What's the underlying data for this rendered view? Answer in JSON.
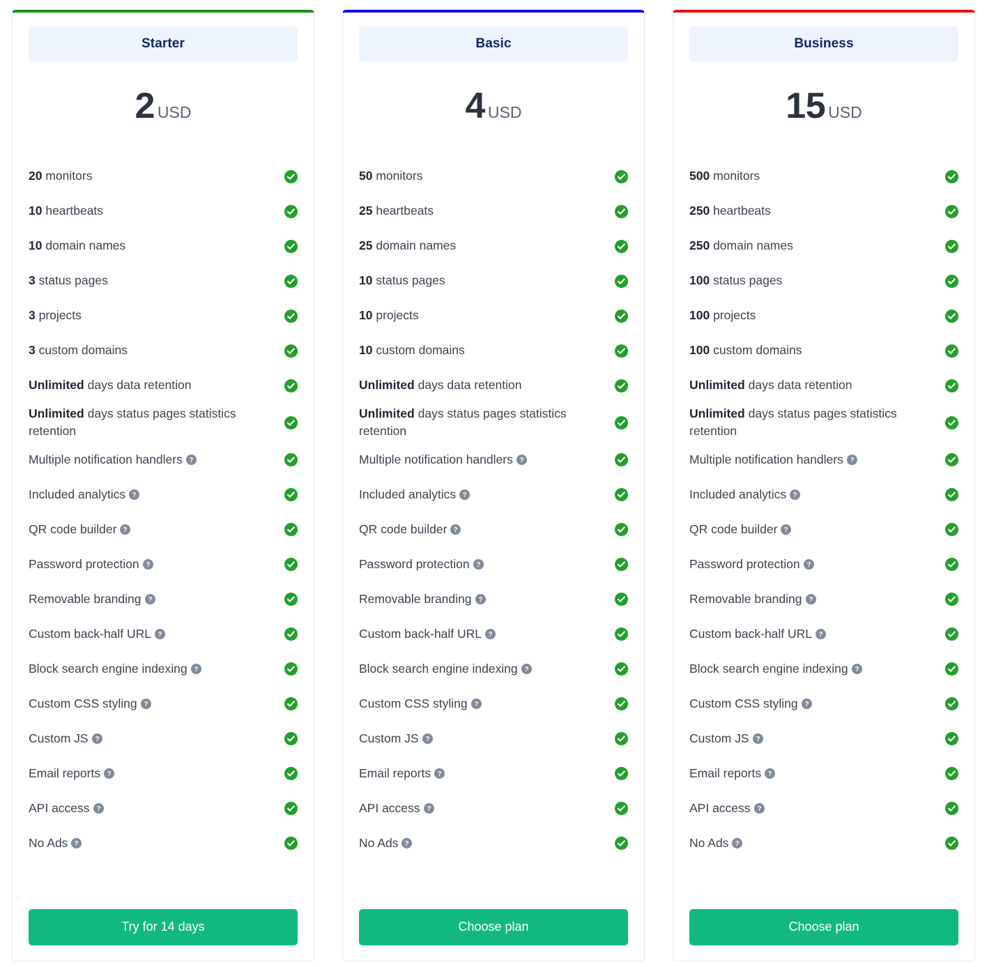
{
  "icons": {
    "check": "check-circle-icon",
    "help": "help-circle-icon"
  },
  "colors": {
    "accent_starter": "#139213",
    "accent_basic": "#0d0df0",
    "accent_business": "#f00a0a",
    "cta_green": "#11b981",
    "check_green": "#22a02b",
    "help_gray": "#818a99",
    "title_bar_bg": "#eef4fd",
    "title_text": "#142664"
  },
  "plans": [
    {
      "id": "starter",
      "name": "Starter",
      "price": "2",
      "currency": "USD",
      "cta_label": "Try for 14 days",
      "features": [
        {
          "qty": "20",
          "label": "monitors",
          "help": false,
          "included": true
        },
        {
          "qty": "10",
          "label": "heartbeats",
          "help": false,
          "included": true
        },
        {
          "qty": "10",
          "label": "domain names",
          "help": false,
          "included": true
        },
        {
          "qty": "3",
          "label": "status pages",
          "help": false,
          "included": true
        },
        {
          "qty": "3",
          "label": "projects",
          "help": false,
          "included": true
        },
        {
          "qty": "3",
          "label": "custom domains",
          "help": false,
          "included": true
        },
        {
          "qty": "Unlimited",
          "label": "days data retention",
          "help": false,
          "included": true
        },
        {
          "qty": "Unlimited",
          "label": "days status pages statistics retention",
          "help": false,
          "included": true
        },
        {
          "qty": "",
          "label": "Multiple notification handlers",
          "help": true,
          "included": true
        },
        {
          "qty": "",
          "label": "Included analytics",
          "help": true,
          "included": true
        },
        {
          "qty": "",
          "label": "QR code builder",
          "help": true,
          "included": true
        },
        {
          "qty": "",
          "label": "Password protection",
          "help": true,
          "included": true
        },
        {
          "qty": "",
          "label": "Removable branding",
          "help": true,
          "included": true
        },
        {
          "qty": "",
          "label": "Custom back-half URL",
          "help": true,
          "included": true
        },
        {
          "qty": "",
          "label": "Block search engine indexing",
          "help": true,
          "included": true
        },
        {
          "qty": "",
          "label": "Custom CSS styling",
          "help": true,
          "included": true
        },
        {
          "qty": "",
          "label": "Custom JS",
          "help": true,
          "included": true
        },
        {
          "qty": "",
          "label": "Email reports",
          "help": true,
          "included": true
        },
        {
          "qty": "",
          "label": "API access",
          "help": true,
          "included": true
        },
        {
          "qty": "",
          "label": "No Ads",
          "help": true,
          "included": true
        }
      ]
    },
    {
      "id": "basic",
      "name": "Basic",
      "price": "4",
      "currency": "USD",
      "cta_label": "Choose plan",
      "features": [
        {
          "qty": "50",
          "label": "monitors",
          "help": false,
          "included": true
        },
        {
          "qty": "25",
          "label": "heartbeats",
          "help": false,
          "included": true
        },
        {
          "qty": "25",
          "label": "domain names",
          "help": false,
          "included": true
        },
        {
          "qty": "10",
          "label": "status pages",
          "help": false,
          "included": true
        },
        {
          "qty": "10",
          "label": "projects",
          "help": false,
          "included": true
        },
        {
          "qty": "10",
          "label": "custom domains",
          "help": false,
          "included": true
        },
        {
          "qty": "Unlimited",
          "label": "days data retention",
          "help": false,
          "included": true
        },
        {
          "qty": "Unlimited",
          "label": "days status pages statistics retention",
          "help": false,
          "included": true
        },
        {
          "qty": "",
          "label": "Multiple notification handlers",
          "help": true,
          "included": true
        },
        {
          "qty": "",
          "label": "Included analytics",
          "help": true,
          "included": true
        },
        {
          "qty": "",
          "label": "QR code builder",
          "help": true,
          "included": true
        },
        {
          "qty": "",
          "label": "Password protection",
          "help": true,
          "included": true
        },
        {
          "qty": "",
          "label": "Removable branding",
          "help": true,
          "included": true
        },
        {
          "qty": "",
          "label": "Custom back-half URL",
          "help": true,
          "included": true
        },
        {
          "qty": "",
          "label": "Block search engine indexing",
          "help": true,
          "included": true
        },
        {
          "qty": "",
          "label": "Custom CSS styling",
          "help": true,
          "included": true
        },
        {
          "qty": "",
          "label": "Custom JS",
          "help": true,
          "included": true
        },
        {
          "qty": "",
          "label": "Email reports",
          "help": true,
          "included": true
        },
        {
          "qty": "",
          "label": "API access",
          "help": true,
          "included": true
        },
        {
          "qty": "",
          "label": "No Ads",
          "help": true,
          "included": true
        }
      ]
    },
    {
      "id": "business",
      "name": "Business",
      "price": "15",
      "currency": "USD",
      "cta_label": "Choose plan",
      "features": [
        {
          "qty": "500",
          "label": "monitors",
          "help": false,
          "included": true
        },
        {
          "qty": "250",
          "label": "heartbeats",
          "help": false,
          "included": true
        },
        {
          "qty": "250",
          "label": "domain names",
          "help": false,
          "included": true
        },
        {
          "qty": "100",
          "label": "status pages",
          "help": false,
          "included": true
        },
        {
          "qty": "100",
          "label": "projects",
          "help": false,
          "included": true
        },
        {
          "qty": "100",
          "label": "custom domains",
          "help": false,
          "included": true
        },
        {
          "qty": "Unlimited",
          "label": "days data retention",
          "help": false,
          "included": true
        },
        {
          "qty": "Unlimited",
          "label": "days status pages statistics retention",
          "help": false,
          "included": true
        },
        {
          "qty": "",
          "label": "Multiple notification handlers",
          "help": true,
          "included": true
        },
        {
          "qty": "",
          "label": "Included analytics",
          "help": true,
          "included": true
        },
        {
          "qty": "",
          "label": "QR code builder",
          "help": true,
          "included": true
        },
        {
          "qty": "",
          "label": "Password protection",
          "help": true,
          "included": true
        },
        {
          "qty": "",
          "label": "Removable branding",
          "help": true,
          "included": true
        },
        {
          "qty": "",
          "label": "Custom back-half URL",
          "help": true,
          "included": true
        },
        {
          "qty": "",
          "label": "Block search engine indexing",
          "help": true,
          "included": true
        },
        {
          "qty": "",
          "label": "Custom CSS styling",
          "help": true,
          "included": true
        },
        {
          "qty": "",
          "label": "Custom JS",
          "help": true,
          "included": true
        },
        {
          "qty": "",
          "label": "Email reports",
          "help": true,
          "included": true
        },
        {
          "qty": "",
          "label": "API access",
          "help": true,
          "included": true
        },
        {
          "qty": "",
          "label": "No Ads",
          "help": true,
          "included": true
        }
      ]
    }
  ]
}
